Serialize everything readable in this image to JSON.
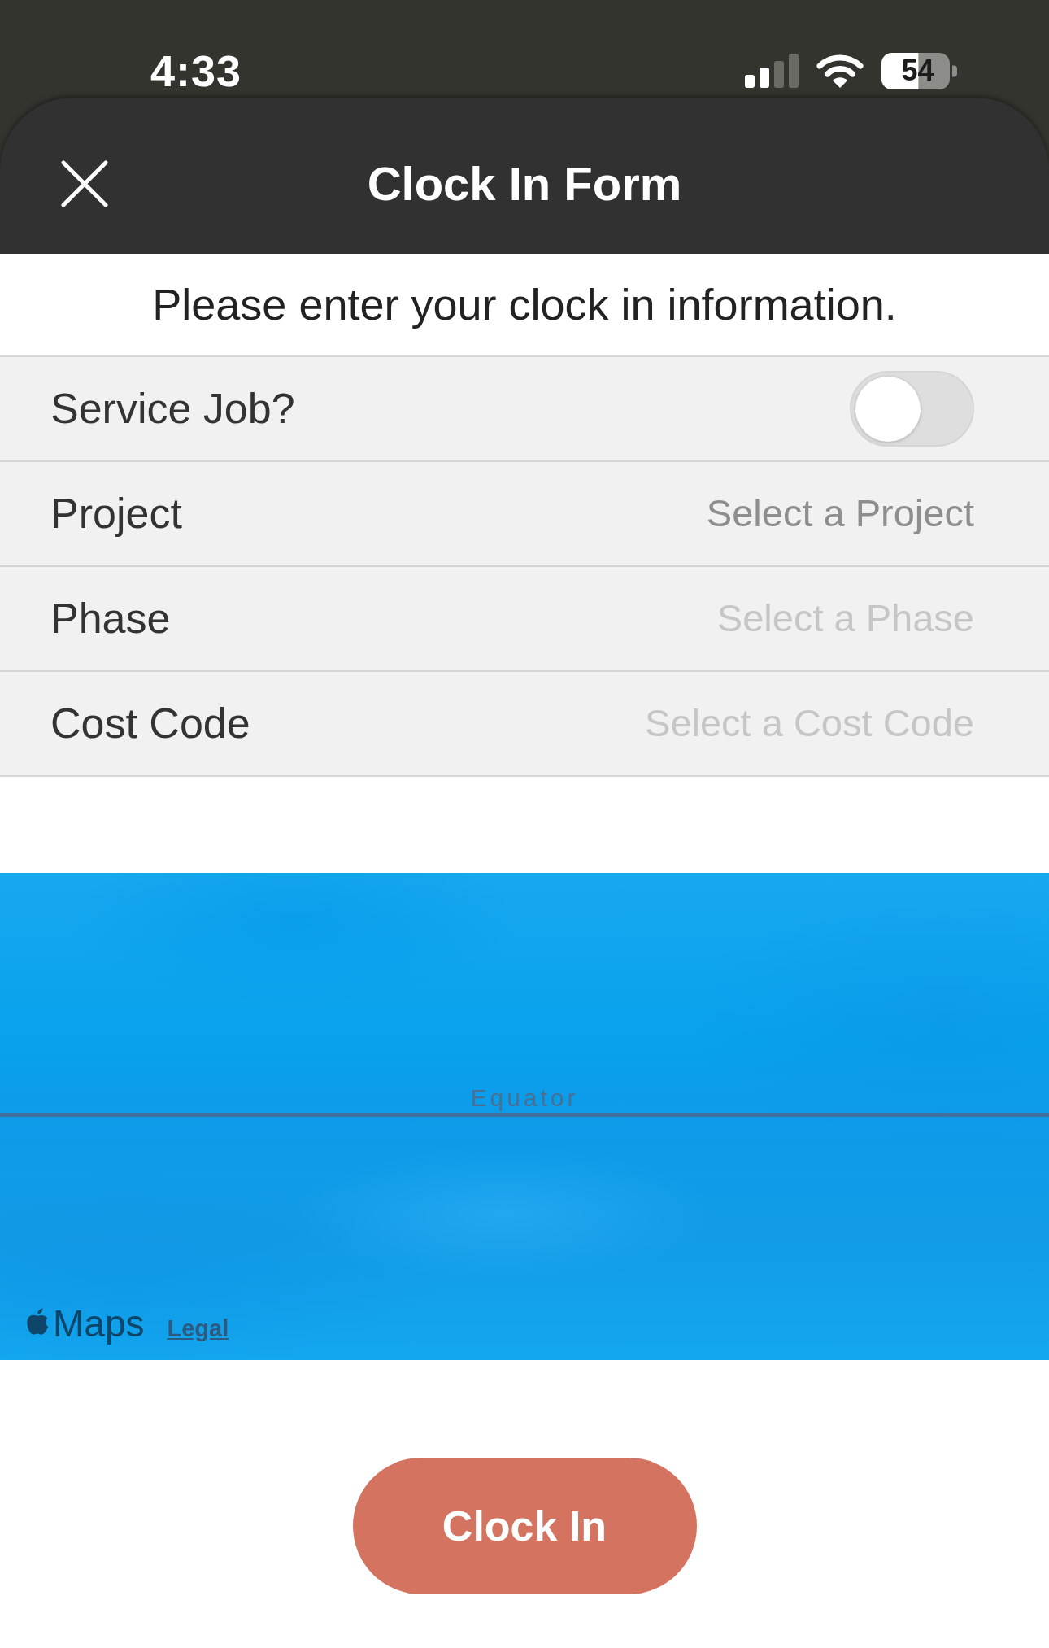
{
  "status_bar": {
    "time": "4:33",
    "battery": "54"
  },
  "header": {
    "title": "Clock In Form"
  },
  "intro": "Please enter your clock in information.",
  "fields": [
    {
      "kind": "toggle",
      "label": "Service Job?",
      "on": false,
      "disabled": false
    },
    {
      "kind": "select",
      "label": "Project",
      "placeholder": "Select a Project",
      "disabled": false
    },
    {
      "kind": "select",
      "label": "Phase",
      "placeholder": "Select a Phase",
      "disabled": true
    },
    {
      "kind": "select",
      "label": "Cost Code",
      "placeholder": "Select a Cost Code",
      "disabled": true
    }
  ],
  "map": {
    "label": "Equator",
    "brand": "Maps",
    "legal_link": "Legal"
  },
  "button": {
    "label": "Clock In"
  }
}
